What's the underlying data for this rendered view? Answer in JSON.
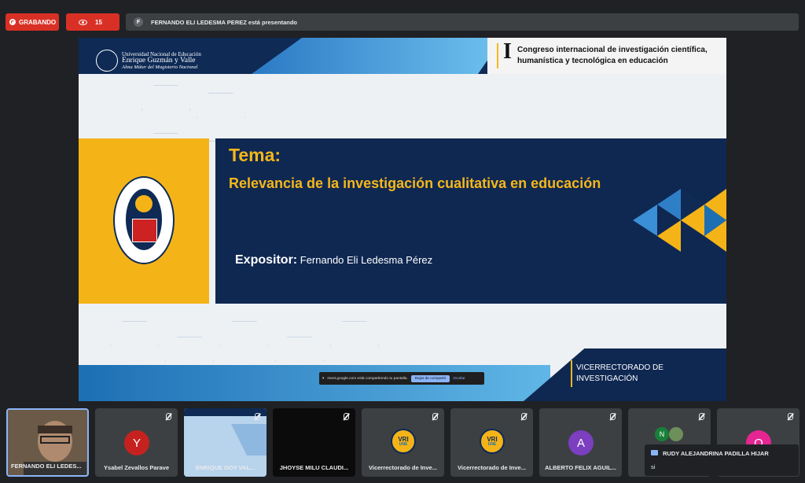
{
  "topbar": {
    "recording_label": "GRABANDO",
    "viewer_count": "15",
    "presenter_initial": "F",
    "presenter_status": "FERNANDO ELI LEDESMA PEREZ está presentando"
  },
  "slide": {
    "university": {
      "line1": "Universidad Nacional de Educación",
      "line2": "Enrique Guzmán y Valle",
      "line3": "Alma Máter del Magisterio Nacional"
    },
    "congress": {
      "roman": "I",
      "line1": "Congreso internacional de investigación científica,",
      "line2": "humanística y tecnológica en educación"
    },
    "tema_label": "Tema:",
    "tema_title": "Relevancia de la investigación cualitativa en educación",
    "expositor_label": "Expositor:",
    "expositor_name": "Fernando Eli Ledesma Pérez",
    "vice_line1": "VICERRECTORADO DE",
    "vice_line2": "INVESTIGACIÓN"
  },
  "share_notice": {
    "text": "meet.google.com está compartiendo tu pantalla.",
    "stop_label": "Dejar de compartir",
    "hide_label": "Ocultar"
  },
  "participants": [
    {
      "name": "FERNANDO ELI LEDES..."
    },
    {
      "name": "Ysabel Zevallos Parave",
      "initial": "Y"
    },
    {
      "name": "ENRIQUE GOY VAL..."
    },
    {
      "name": "JHOYSE MILU CLAUDI..."
    },
    {
      "name": "Vicerrectorado de Inve...",
      "logo_text": "VRI",
      "logo_sub": "UNE"
    },
    {
      "name": "Vicerrectorado de Inve...",
      "logo_text": "VRI",
      "logo_sub": "UNE"
    },
    {
      "name": "ALBERTO FELIX AGUIL...",
      "initial": "A"
    },
    {
      "initial": "N"
    },
    {
      "initial": "O"
    }
  ],
  "chat": {
    "sender": "RUDY ALEJANDRINA PADILLA HIJAR",
    "message": "si"
  },
  "colors": {
    "record_red": "#d93025",
    "slide_navy": "#0f2852",
    "slide_gold": "#f4b418",
    "meet_bg": "#202124"
  }
}
